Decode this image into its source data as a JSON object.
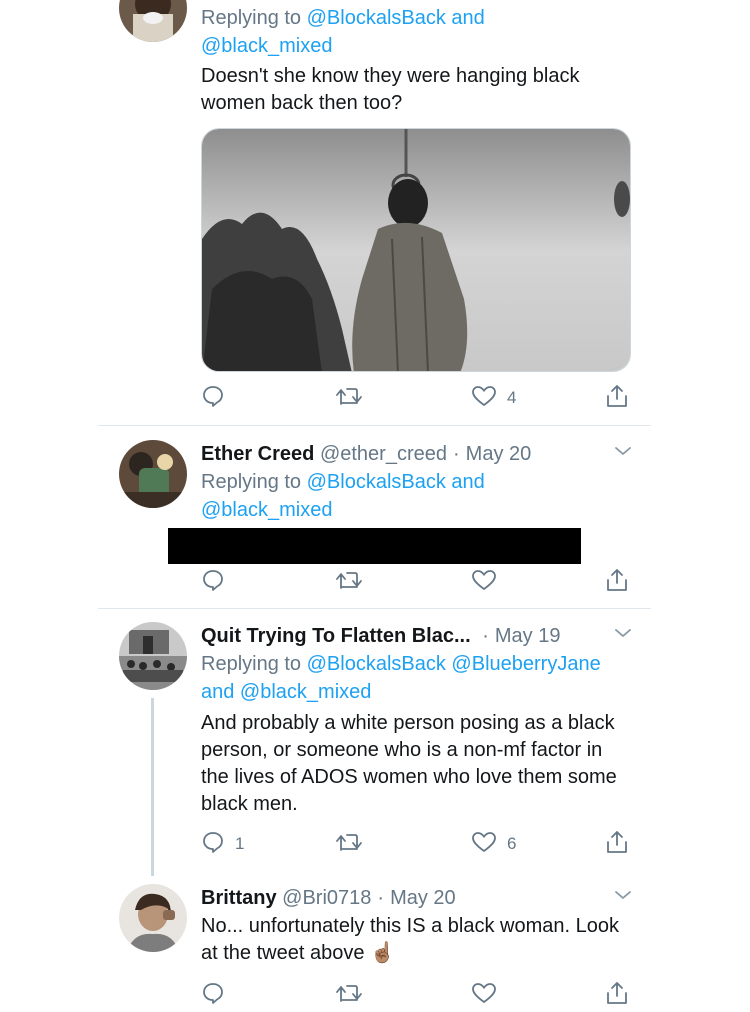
{
  "tweets": [
    {
      "reply_prefix": "Replying to",
      "reply_line1": "@BlockalsBack and",
      "reply_line2": "@black_mixed",
      "text": "Doesn't she know they were hanging black women back then too?",
      "actions": {
        "reply": "",
        "retweet": "",
        "like": "4"
      }
    },
    {
      "name": "Ether Creed",
      "handle": "@ether_creed",
      "date": "May 20",
      "reply_prefix": "Replying to",
      "reply_line1": "@BlockalsBack and",
      "reply_line2": "@black_mixed",
      "actions": {
        "reply": "",
        "retweet": "",
        "like": ""
      }
    },
    {
      "name": "Quit Trying To Flatten Blac...",
      "date": "May 19",
      "reply_prefix": "Replying to",
      "reply_line1": "@BlockalsBack @BlueberryJane",
      "reply_line2": "and @black_mixed",
      "text": "And probably a white person posing as a black person, or someone who is a non-mf factor in the lives of ADOS women who love them some black men.",
      "actions": {
        "reply": "1",
        "retweet": "",
        "like": "6"
      }
    },
    {
      "name": "Brittany",
      "handle": "@Bri0718",
      "date": "May 20",
      "text": "No... unfortunately this IS a black woman. Look at the tweet above ☝🏽",
      "actions": {
        "reply": "",
        "retweet": "",
        "like": ""
      }
    }
  ],
  "separator": "·",
  "icons": {
    "reply": "reply-icon",
    "retweet": "retweet-icon",
    "like": "heart-icon",
    "share": "share-icon",
    "more": "chevron-down-icon"
  },
  "colors": {
    "link": "#1da1f2",
    "secondary_text": "#657786",
    "primary_text": "#14171a",
    "divider": "#e1e8ed",
    "thread_line": "#ccd6dd"
  }
}
